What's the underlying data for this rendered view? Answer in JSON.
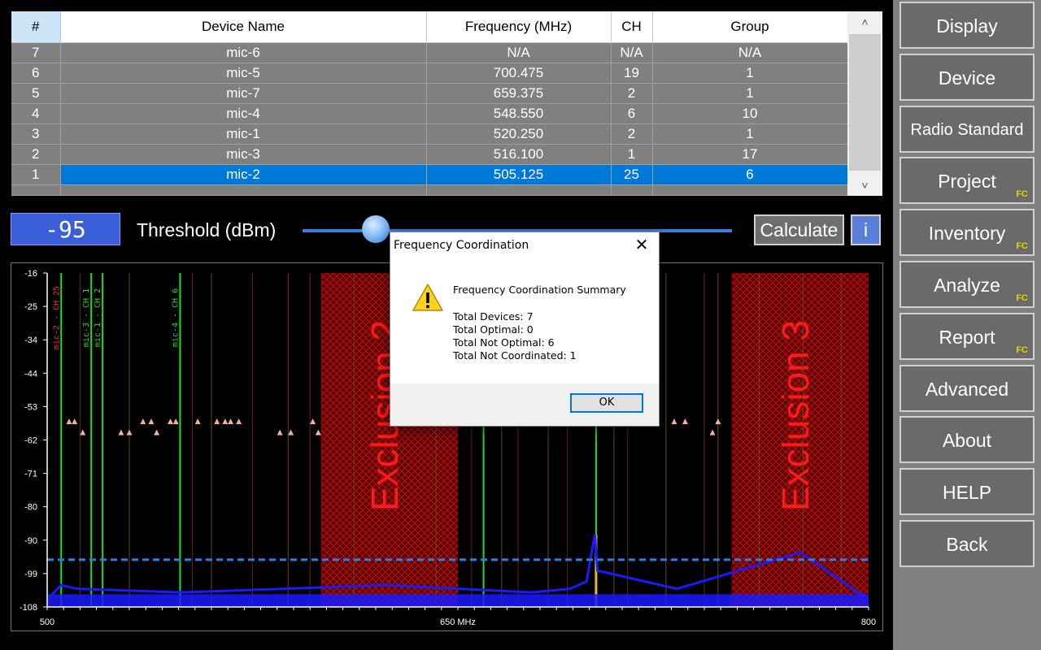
{
  "table": {
    "columns": [
      "#",
      "Device Name",
      "Frequency (MHz)",
      "CH",
      "Group"
    ],
    "rows": [
      [
        "7",
        "mic-6",
        "N/A",
        "N/A",
        "N/A"
      ],
      [
        "6",
        "mic-5",
        "700.475",
        "19",
        "1"
      ],
      [
        "5",
        "mic-7",
        "659.375",
        "2",
        "1"
      ],
      [
        "4",
        "mic-4",
        "548.550",
        "6",
        "10"
      ],
      [
        "3",
        "mic-1",
        "520.250",
        "2",
        "1"
      ],
      [
        "2",
        "mic-3",
        "516.100",
        "1",
        "17"
      ],
      [
        "1",
        "mic-2",
        "505.125",
        "25",
        "6"
      ]
    ],
    "selected_row": 6,
    "scroll_up_icon": "chevron-up-icon",
    "scroll_down_icon": "chevron-down-icon"
  },
  "threshold": {
    "value": "-95",
    "label": "Threshold (dBm)",
    "slider_fraction": 0.17
  },
  "buttons": {
    "calculate": "Calculate",
    "info": "i"
  },
  "chart_data": {
    "type": "line",
    "xlim": [
      500,
      800
    ],
    "ylim": [
      -108,
      -16
    ],
    "x_tick_labels": [
      "500",
      "650 MHz",
      "800"
    ],
    "y_tick_labels": [
      "-16",
      "-25",
      "-34",
      "-44",
      "-53",
      "-62",
      "-71",
      "-80",
      "-90",
      "-99",
      "-108"
    ],
    "threshold_dbm": -95,
    "exclusion_zones": [
      {
        "label": "Exclusion 2",
        "x": [
          600,
          650
        ]
      },
      {
        "label": "Exclusion 3",
        "x": [
          750,
          800
        ]
      }
    ],
    "device_markers": [
      {
        "label": "mic-2 - CH 25",
        "x": 505.125
      },
      {
        "label": "mic-3 - CH 1",
        "x": 516.1
      },
      {
        "label": "mic-1 - CH 2",
        "x": 520.25
      },
      {
        "label": "mic-4 - CH 6",
        "x": 548.55
      },
      {
        "label": "",
        "x": 659.375
      },
      {
        "label": "",
        "x": 700.475
      }
    ],
    "noise_floor": [
      {
        "x": 500,
        "y": -106
      },
      {
        "x": 505.125,
        "y": -102
      },
      {
        "x": 511,
        "y": -103
      },
      {
        "x": 548.55,
        "y": -104
      },
      {
        "x": 624,
        "y": -102
      },
      {
        "x": 677,
        "y": -104
      },
      {
        "x": 691,
        "y": -103
      },
      {
        "x": 697,
        "y": -101
      },
      {
        "x": 700,
        "y": -88
      },
      {
        "x": 701,
        "y": -98
      },
      {
        "x": 730,
        "y": -103
      },
      {
        "x": 775,
        "y": -93
      },
      {
        "x": 800,
        "y": -106
      }
    ],
    "colors": {
      "spectrum": "#1a1aff",
      "threshold": "#2f7fe0",
      "device_line": "#22dd22",
      "exclusion": "#aa0000",
      "exclusion_text": "#ff1a1a",
      "marker": "#f0b0a0"
    }
  },
  "dialog": {
    "title": "Frequency Coordination",
    "icon": "warning-icon",
    "heading": "Frequency Coordination Summary",
    "lines": [
      "Total Devices: 7",
      "Total Optimal: 0",
      "Total Not Optimal: 6",
      "Total Not Coordinated: 1"
    ],
    "ok": "OK",
    "close_icon": "close-icon"
  },
  "nav": [
    {
      "label": "Display",
      "fc": ""
    },
    {
      "label": "Device",
      "fc": ""
    },
    {
      "label": "Radio Standard",
      "fc": ""
    },
    {
      "label": "Project",
      "fc": "FC"
    },
    {
      "label": "Inventory",
      "fc": "FC"
    },
    {
      "label": "Analyze",
      "fc": "FC"
    },
    {
      "label": "Report",
      "fc": "FC"
    },
    {
      "label": "Advanced",
      "fc": ""
    },
    {
      "label": "About",
      "fc": ""
    },
    {
      "label": "HELP",
      "fc": ""
    },
    {
      "label": "Back",
      "fc": ""
    }
  ]
}
